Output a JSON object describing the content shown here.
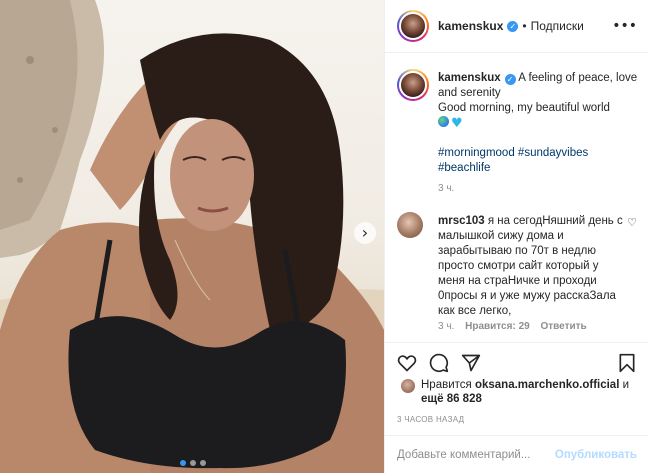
{
  "post": {
    "username": "kamenskux",
    "separator": "•",
    "follow_label": "Подписки",
    "more_icon": "•••"
  },
  "caption": {
    "username": "kamenskux",
    "line1": " A feeling of peace, love and serenity",
    "line2": "Good morning, my beautiful world",
    "hashtag1": "#morningmood",
    "hashtag2": "#sundayvibes",
    "hashtag3": "#beachlife",
    "time": "3 ч."
  },
  "comment": {
    "username": "mrsc103",
    "text": " я на сегодНяшний день с малышкой сижу дома и зарабытываю по 70т в недлю просто смотри сайт который у меня на страНичке и проходи 0просы я и уже мужу расскаЗала как все легко,",
    "time": "3 ч.",
    "likes": "Нравится: 29",
    "reply": "Ответить"
  },
  "likes": {
    "prefix": "Нравится ",
    "user": "oksana.marchenko.official",
    "middle": " и ",
    "rest": "ещё 86 828"
  },
  "timestamp": "3 ЧАСОВ НАЗАД",
  "add_comment": {
    "placeholder": "Добавьте комментарий...",
    "post_label": "Опубликовать"
  },
  "colors": {
    "link": "#00376b",
    "verified": "#3897f0",
    "post_disabled": "#b3dbff"
  },
  "carousel": {
    "total_slides": 3,
    "active_slide": 1
  }
}
